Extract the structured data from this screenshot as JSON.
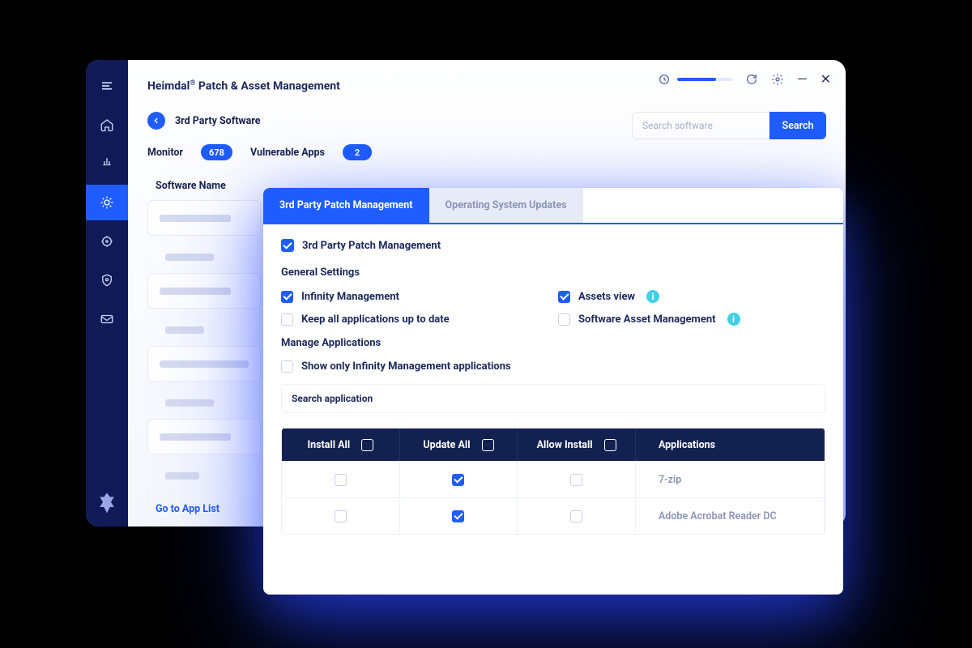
{
  "app": {
    "title_prefix": "Heimdal",
    "title_suffix": " Patch & Asset Management",
    "search_placeholder": "Search software",
    "search_button": "Search"
  },
  "crumb": {
    "label": "3rd Party Software"
  },
  "metrics": {
    "monitor_label": "Monitor",
    "monitor_count": "678",
    "vuln_label": "Vulnerable Apps",
    "vuln_count": "2"
  },
  "column_header": "Software Name",
  "go_to_app_list": "Go to App List",
  "tabs": {
    "active": "3rd Party Patch Management",
    "inactive": "Operating System Updates"
  },
  "panel": {
    "toggle_main": "3rd Party Patch Management",
    "general_settings": "General Settings",
    "infinity": "Infinity Management",
    "keep_updated": "Keep all applications up to date",
    "assets_view": "Assets view",
    "sam": "Software Asset Management",
    "manage_apps": "Manage Applications",
    "show_only_infinity": "Show only Infinity Management applications",
    "search_app_placeholder": "Search application"
  },
  "table": {
    "headers": {
      "install_all": "Install All",
      "update_all": "Update All",
      "allow_install": "Allow Install",
      "applications": "Applications"
    },
    "rows": [
      {
        "install": false,
        "update": true,
        "allow": false,
        "name": "7-zip"
      },
      {
        "install": false,
        "update": true,
        "allow": false,
        "name": "Adobe Acrobat Reader DC"
      }
    ]
  }
}
